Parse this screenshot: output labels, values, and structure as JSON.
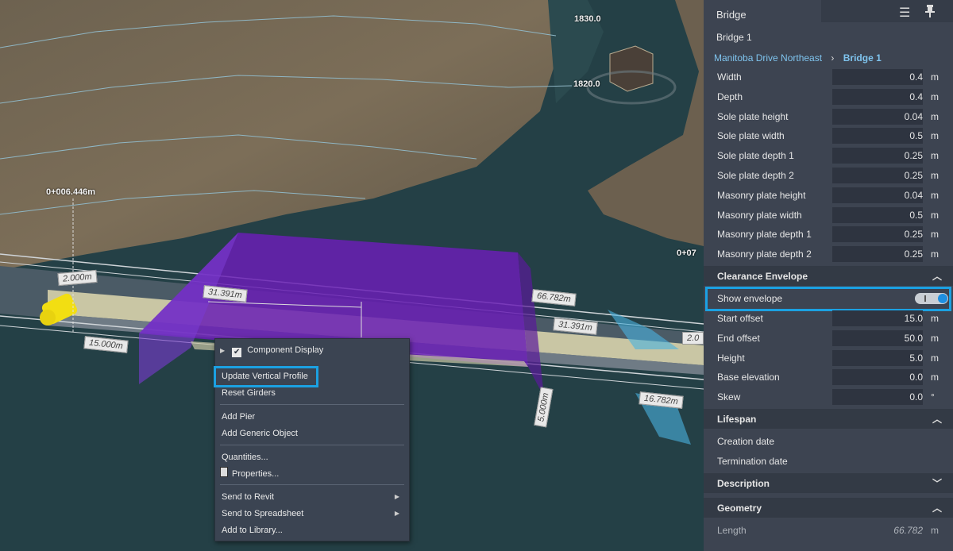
{
  "viewport": {
    "contours": [
      "1830.0",
      "1820.0"
    ],
    "station": "0+006.446m",
    "station_right": "0+07",
    "dims": [
      "2.000m",
      "31.391m",
      "15.000m",
      "66.782m",
      "31.391m",
      "5.000m",
      "16.782m",
      "2.0"
    ]
  },
  "context_menu": {
    "items": [
      "Component Display",
      "Update Vertical Profile",
      "Reset Girders",
      "Add Pier",
      "Add Generic Object",
      "Quantities...",
      "Properties...",
      "Send to Revit",
      "Send to Spreadsheet",
      "Add to Library..."
    ]
  },
  "panel": {
    "tab_title": "Bridge",
    "name": "Bridge 1",
    "breadcrumb": [
      "Manitoba Drive Northeast",
      "Bridge 1"
    ],
    "props": [
      {
        "label": "Width",
        "value": "0.4",
        "unit": "m"
      },
      {
        "label": "Depth",
        "value": "0.4",
        "unit": "m"
      },
      {
        "label": "Sole plate height",
        "value": "0.04",
        "unit": "m"
      },
      {
        "label": "Sole plate width",
        "value": "0.5",
        "unit": "m"
      },
      {
        "label": "Sole plate depth 1",
        "value": "0.25",
        "unit": "m"
      },
      {
        "label": "Sole plate depth 2",
        "value": "0.25",
        "unit": "m"
      },
      {
        "label": "Masonry plate height",
        "value": "0.04",
        "unit": "m"
      },
      {
        "label": "Masonry plate width",
        "value": "0.5",
        "unit": "m"
      },
      {
        "label": "Masonry plate depth 1",
        "value": "0.25",
        "unit": "m"
      },
      {
        "label": "Masonry plate depth 2",
        "value": "0.25",
        "unit": "m"
      }
    ],
    "clearance": {
      "title": "Clearance Envelope",
      "show_envelope": "Show envelope",
      "props": [
        {
          "label": "Start offset",
          "value": "15.0",
          "unit": "m"
        },
        {
          "label": "End offset",
          "value": "50.0",
          "unit": "m"
        },
        {
          "label": "Height",
          "value": "5.0",
          "unit": "m"
        },
        {
          "label": "Base elevation",
          "value": "0.0",
          "unit": "m"
        },
        {
          "label": "Skew",
          "value": "0.0",
          "unit": "°"
        }
      ]
    },
    "lifespan": {
      "title": "Lifespan",
      "creation": "Creation date",
      "termination": "Termination date"
    },
    "description": {
      "title": "Description"
    },
    "geometry": {
      "title": "Geometry",
      "length_label": "Length",
      "length_value": "66.782",
      "length_unit": "m"
    }
  },
  "colors": {
    "highlight": "#1ba1e2",
    "envelope": "#6a1fb5",
    "panel_bg": "#3d4451"
  }
}
